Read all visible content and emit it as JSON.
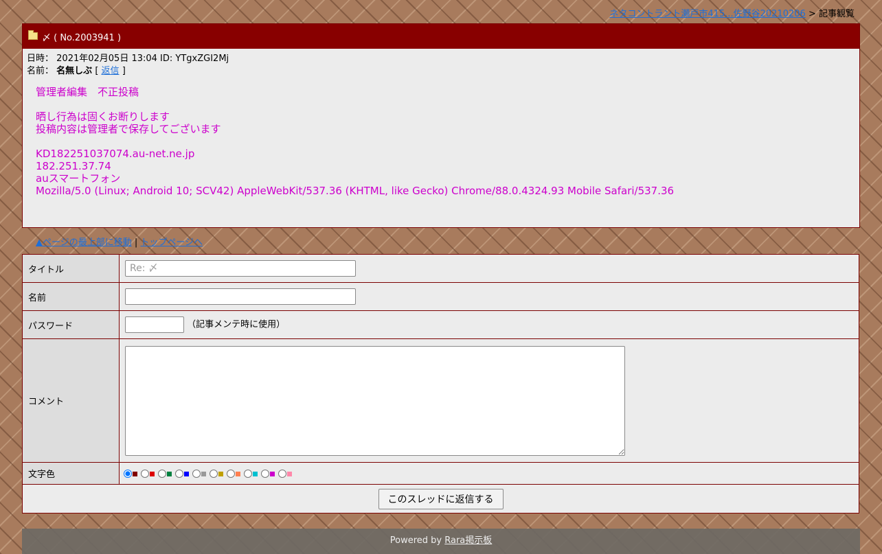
{
  "breadcrumb": {
    "link": "ネタコントラント瀬戸市415...佐野谷20210206",
    "separator": ">",
    "current": "記事観覧"
  },
  "post": {
    "icon": "folder-icon",
    "title": "〆 ( No.2003941 )",
    "date_label": "日時：",
    "date_value": "2021年02月05日 13:04 ID: YTgxZGI2Mj",
    "name_label": "名前：",
    "name_value": "名無しぶ",
    "reply_open": "[",
    "reply_link": "返信",
    "reply_close": "]",
    "text_color": "#cc00cc",
    "body_lines": [
      "管理者編集　不正投稿",
      "",
      "晒し行為は固くお断りします",
      "投稿内容は管理者で保存してございます",
      "",
      "KD182251037074.au-net.ne.jp",
      "182.251.37.74",
      "auスマートフォン",
      "Mozilla/5.0 (Linux; Android 10; SCV42) AppleWebKit/537.36 (KHTML, like Gecko) Chrome/88.0.4324.93 Mobile Safari/537.36"
    ]
  },
  "nav": {
    "prev_link": "▲ページの最上部に移動",
    "separator": "|",
    "top_link": "トップページへ"
  },
  "form": {
    "title_label": "タイトル",
    "title_placeholder": "Re: 〆",
    "name_label": "名前",
    "password_label": "パスワード",
    "password_note": "（記事メンテ時に使用）",
    "comment_label": "コメント",
    "color_label": "文字色",
    "colors": [
      "#800000",
      "#dd0000",
      "#008040",
      "#0000ff",
      "#999999",
      "#c0a000",
      "#ff7f50",
      "#00c0d0",
      "#cc00cc",
      "#ff88aa"
    ],
    "selected_color": 0,
    "submit_label": "このスレッドに返信する"
  },
  "footer": {
    "prefix": "Powered by",
    "link": "Rara掲示板"
  }
}
